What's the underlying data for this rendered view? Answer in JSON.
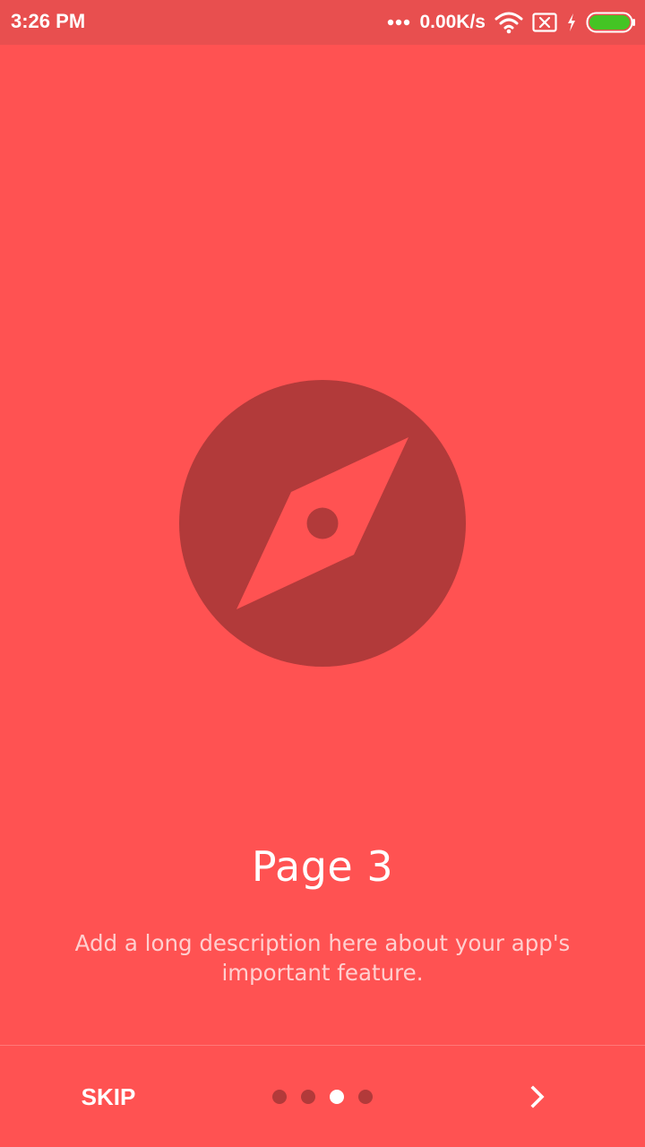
{
  "status_bar": {
    "time": "3:26 PM",
    "net_speed": "0.00K/s",
    "icons": [
      "more-dots-icon",
      "wifi-icon",
      "no-sim-icon",
      "charging-bolt-icon",
      "battery-icon"
    ],
    "battery_color": "#44C424"
  },
  "slide": {
    "icon": "compass-icon",
    "title": "Page 3",
    "description": "Add a long description here about your app's important feature."
  },
  "footer": {
    "skip_label": "SKIP",
    "page_count": 4,
    "current_page": 3,
    "next_icon": "chevron-right-icon"
  },
  "colors": {
    "background": "#FF5252",
    "status_bar": "#E84F4F",
    "icon_dark": "#B23A3A",
    "dot_inactive": "#B23A3A",
    "dot_active": "#FFFFFF"
  }
}
